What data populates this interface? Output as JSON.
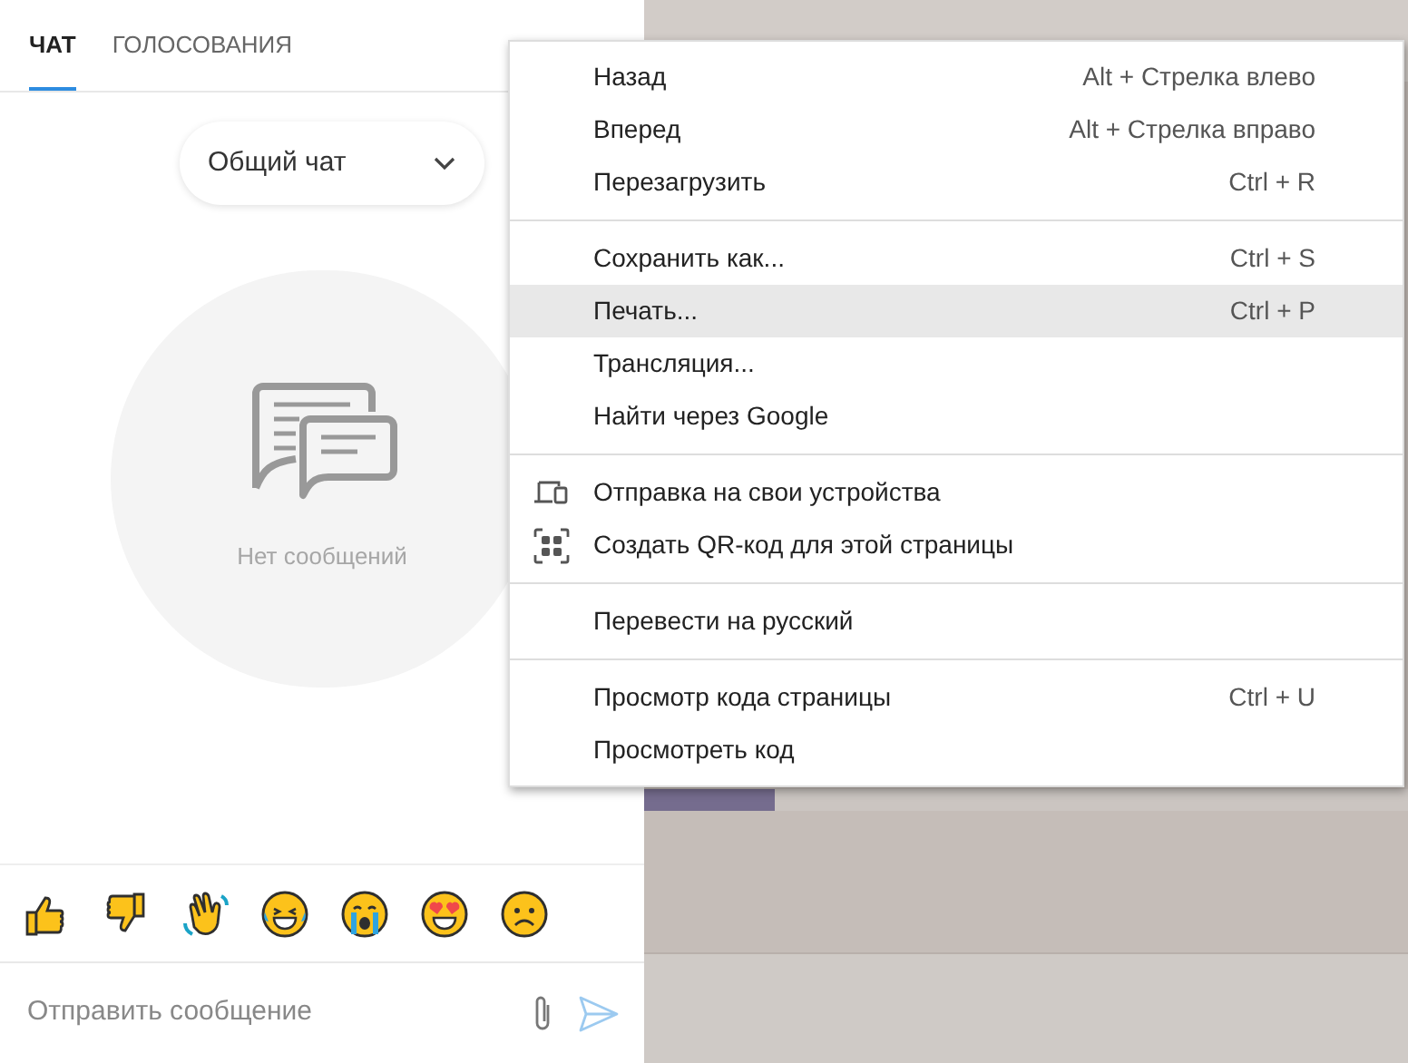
{
  "tabs": [
    {
      "label": "ЧАТ",
      "selected": true
    },
    {
      "label": "ГОЛОСОВАНИЯ",
      "selected": false
    }
  ],
  "chat_selector": {
    "value": "Общий чат"
  },
  "empty_state": {
    "text": "Нет сообщений"
  },
  "message_input": {
    "placeholder": "Отправить сообщение"
  },
  "context_menu": {
    "groups": [
      [
        {
          "label": "Назад",
          "shortcut": "Alt + Стрелка влево",
          "selected": false
        },
        {
          "label": "Вперед",
          "shortcut": "Alt + Стрелка вправо",
          "selected": false
        },
        {
          "label": "Перезагрузить",
          "shortcut": "Ctrl + R",
          "selected": false
        }
      ],
      [
        {
          "label": "Сохранить как...",
          "shortcut": "Ctrl + S",
          "selected": false
        },
        {
          "label": "Печать...",
          "shortcut": "Ctrl + P",
          "selected": true
        },
        {
          "label": "Трансляция...",
          "selected": false
        },
        {
          "label": "Найти через Google",
          "selected": false
        }
      ],
      [
        {
          "label": "Отправка на свои устройства",
          "kind": "devices",
          "selected": false
        },
        {
          "label": "Создать QR-код для этой страницы",
          "kind": "qr",
          "selected": false
        }
      ],
      [
        {
          "label": "Перевести на русский",
          "selected": false
        }
      ],
      [
        {
          "label": "Просмотр кода страницы",
          "shortcut": "Ctrl + U",
          "selected": false
        },
        {
          "label": "Просмотреть код",
          "selected": false
        }
      ]
    ]
  }
}
